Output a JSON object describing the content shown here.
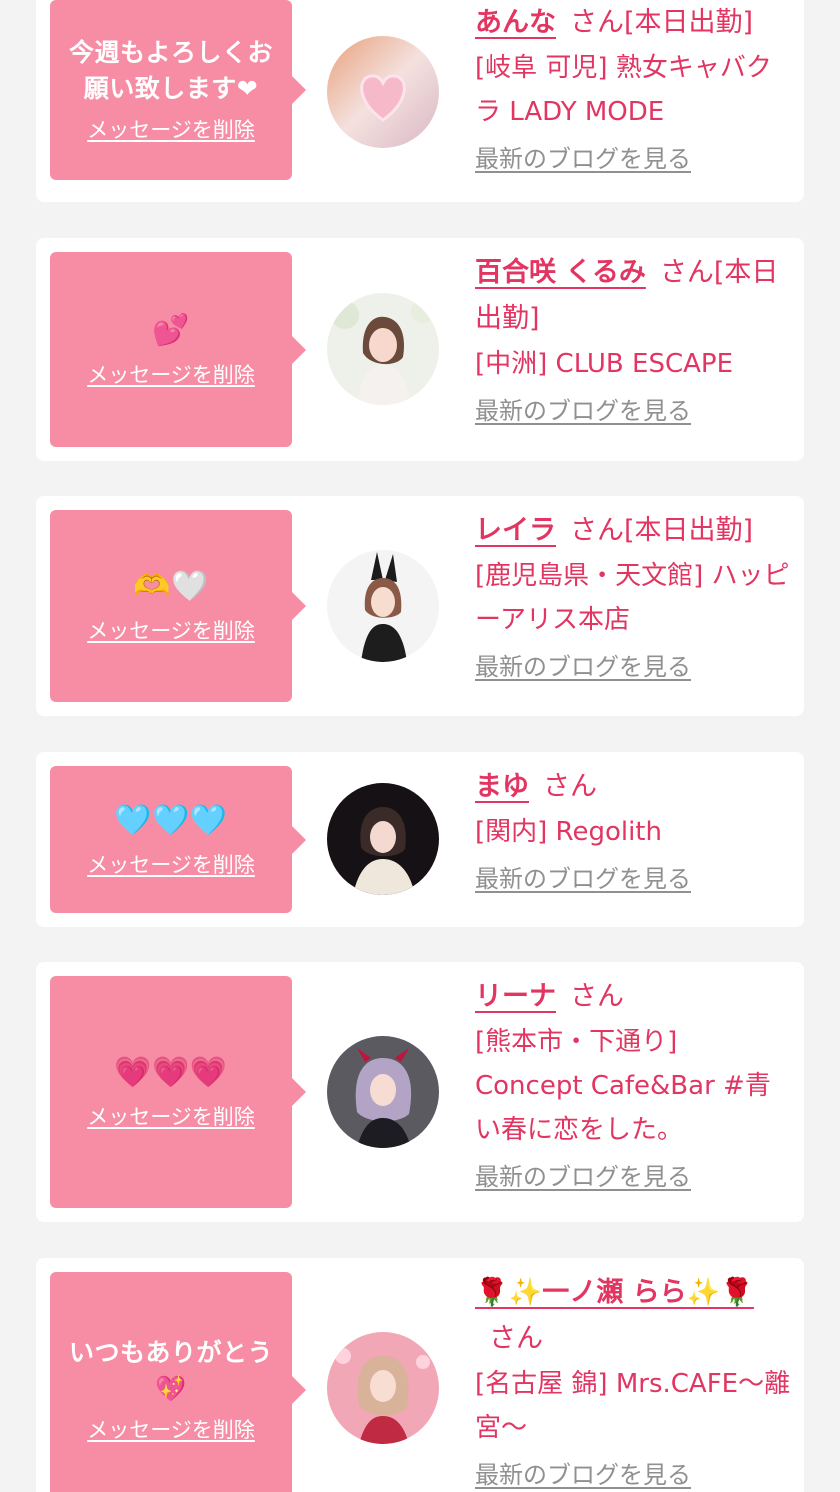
{
  "common": {
    "delete_label": "メッセージを削除",
    "san_label": "さん",
    "blog_label": "最新のブログを見る"
  },
  "colors": {
    "bubble": "#f78da4",
    "accent": "#e23561",
    "muted": "#909090",
    "page_bg": "#f3f3f3"
  },
  "messages": [
    {
      "message": "今週もよろしくお願い致します❤",
      "name": "あんな",
      "shop_line1": "[本日出勤]",
      "shop_line2": "[岐阜 可児] 熟女キャバクラ LADY MODE"
    },
    {
      "message": "💕",
      "name": "百合咲 くるみ",
      "shop_line1": "[本日出勤]",
      "shop_line2": "[中洲] CLUB ESCAPE"
    },
    {
      "message": "🫶🤍",
      "name": "レイラ",
      "shop_line1": "[本日出勤]",
      "shop_line2": "[鹿児島県・天文館] ハッピーアリス本店"
    },
    {
      "message": "🩵🩵🩵",
      "name": "まゆ",
      "shop_line1": "",
      "shop_line2": "[関内] Regolith"
    },
    {
      "message": "💗💗💗",
      "name": "リーナ",
      "shop_line1": "",
      "shop_line2": "[熊本市・下通り] Concept Cafe&Bar #青い春に恋をした。"
    },
    {
      "message": "いつもありがとう💖",
      "name": "🌹✨一ノ瀬 らら✨🌹",
      "shop_line1": "",
      "shop_line2": "[名古屋 錦] Mrs.CAFE〜離宮〜"
    }
  ]
}
